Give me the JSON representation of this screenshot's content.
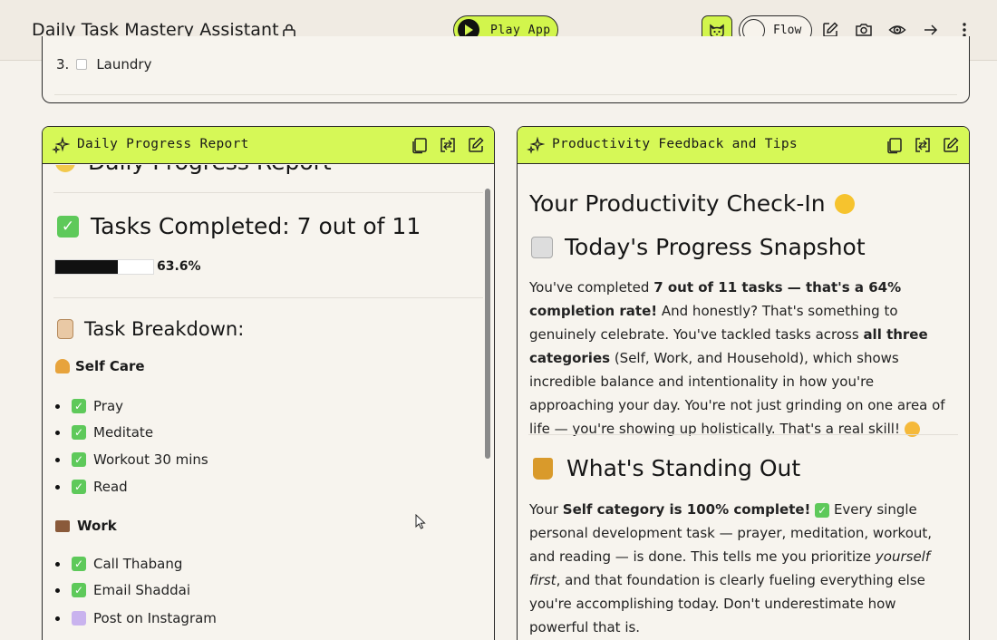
{
  "header": {
    "title": "Daily Task Mastery Assistant",
    "play_label": "Play App",
    "flow_label": "Flow",
    "icons": [
      "lock-icon",
      "cat-icon",
      "edit-icon",
      "camera-icon",
      "eye-icon",
      "arrow-right-icon",
      "more-vertical-icon"
    ]
  },
  "top_card": {
    "item_number": "3.",
    "item_label": "Laundry"
  },
  "left_panel": {
    "header_title": "Daily Progress Report",
    "clipped_heading": "Daily Progress Report",
    "tasks_heading": "Tasks Completed: 7 out of 11",
    "progress_percent_label": "63.6%",
    "progress_value": 0.636,
    "breakdown_heading": "Task Breakdown:",
    "self_care_heading": "Self Care",
    "self_care_items": [
      "Pray",
      "Meditate",
      "Workout 30 mins",
      "Read"
    ],
    "work_heading": "Work",
    "work_items": [
      "Call Thabang",
      "Email Shaddai",
      "Post on Instagram"
    ]
  },
  "right_panel": {
    "header_title": "Productivity Feedback and Tips",
    "checkin_heading": "Your Productivity Check-In",
    "snapshot_heading": "Today's Progress Snapshot",
    "snapshot_p": {
      "t1": "You've completed ",
      "b1": "7 out of 11 tasks — that's a 64% completion rate!",
      "t2": " And honestly? That's something to genuinely celebrate. You've tackled tasks across ",
      "b2": "all three categories",
      "t3": " (Self, Work, and Household), which shows incredible balance and intentionality in how you're approaching your day. You're not just grinding on one area of life — you're showing up holistically. That's a real skill!"
    },
    "standing_heading": "What's Standing Out",
    "standing_p": {
      "t1": "Your ",
      "b1": "Self category is 100% complete!",
      "t2": " Every single personal development task — prayer, meditation, workout, and reading — is done. This tells me you prioritize ",
      "i1": "yourself first",
      "t3": ", and that foundation is clearly fueling everything else you're accomplishing today. Don't underestimate how powerful that is."
    }
  },
  "colors": {
    "accent": "#d6f857",
    "background": "#f5f2ec",
    "border": "#2a2a2a"
  }
}
